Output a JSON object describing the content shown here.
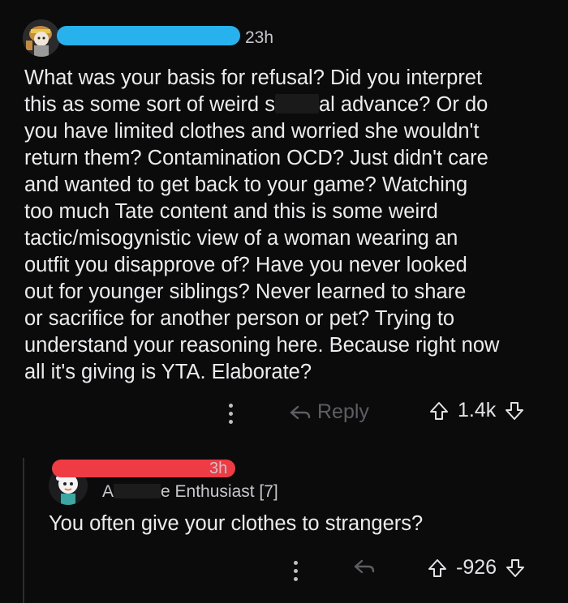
{
  "parent_comment": {
    "time": "23h",
    "body_part1": "What was your basis for refusal? Did you interpret\nthis as some sort of weird s",
    "body_part2": "al advance? Or do\nyou have limited clothes and worried she wouldn't\nreturn them? Contamination OCD? Just didn't care\nand wanted to get back to your game? Watching\ntoo much Tate content and this is some weird\ntactic/misogynistic view of a woman wearing an\noutfit you disapprove of? Have you never looked\nout for younger siblings? Never learned to share\nor sacrifice for another person or pet? Trying to\nunderstand your reasoning here. Because right now\nall it's giving is YTA. Elaborate?",
    "reply_label": "Reply",
    "score": "1.4k"
  },
  "reply_comment": {
    "time": "3h",
    "flair_start": "A",
    "flair_end": "e Enthusiast [7]",
    "body": "You often give your clothes to strangers?",
    "score": "-926"
  },
  "colors": {
    "background": "#0b0b0c",
    "redaction_blue": "#27b2ee",
    "redaction_red": "#ee3b44"
  },
  "icons": [
    "more-options-icon",
    "reply-arrow-icon",
    "upvote-icon",
    "downvote-icon"
  ]
}
